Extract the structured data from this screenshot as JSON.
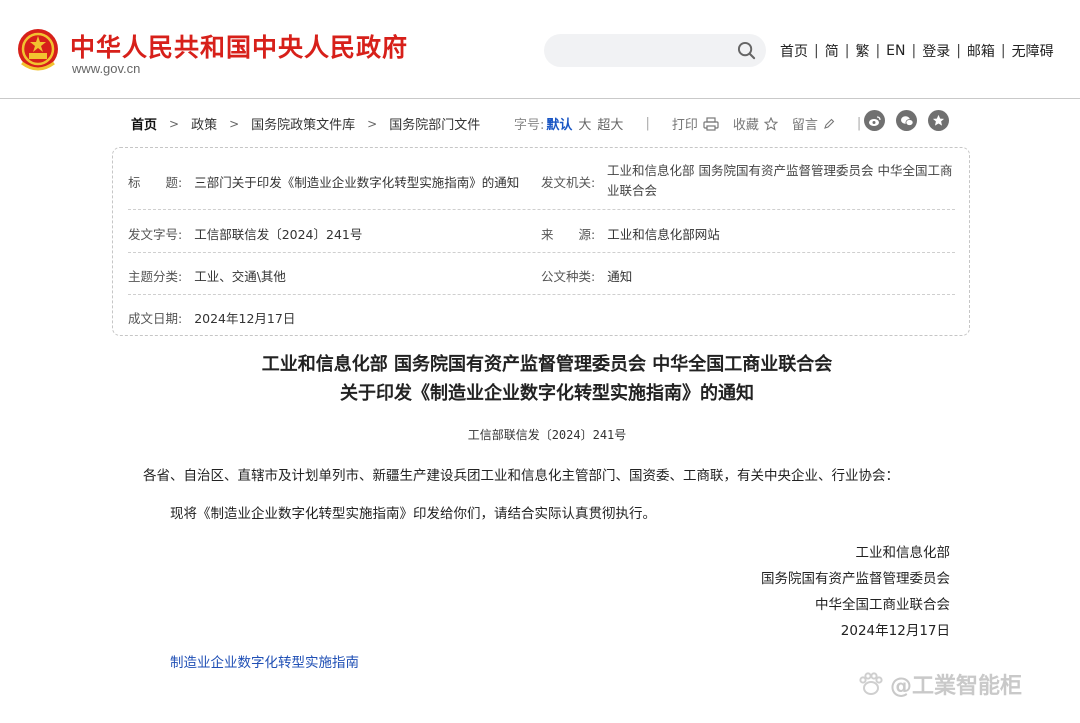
{
  "header": {
    "site_title": "中华人民共和国中央人民政府",
    "site_url": "www.gov.cn",
    "nav": [
      "首页",
      "简",
      "繁",
      "EN",
      "登录",
      "邮箱",
      "无障碍"
    ],
    "search_icon": "search-icon"
  },
  "breadcrumb": [
    "首页",
    "政策",
    "国务院政策文件库",
    "国务院部门文件"
  ],
  "toolbar": {
    "font_label": "字号:",
    "font_sizes": [
      "默认",
      "大",
      "超大"
    ],
    "print": "打印",
    "favorite": "收藏",
    "comment": "留言"
  },
  "info": {
    "title_key": "标　　题:",
    "title_val": "三部门关于印发《制造业企业数字化转型实施指南》的通知",
    "issuer_key": "发文机关:",
    "issuer_val_1": "工业和信息化部 国务院国有资产监督管理委员会 中华全国工商",
    "issuer_val_2": "业联合会",
    "docno_key": "发文字号:",
    "docno_val": "工信部联信发〔2024〕241号",
    "source_key": "来　　源:",
    "source_val": "工业和信息化部网站",
    "category_key": "主题分类:",
    "category_val": "工业、交通\\其他",
    "type_key": "公文种类:",
    "type_val": "通知",
    "date_key": "成文日期:",
    "date_val": "2024年12月17日"
  },
  "article": {
    "title_line1": "工业和信息化部 国务院国有资产监督管理委员会 中华全国工商业联合会",
    "title_line2": "关于印发《制造业企业数字化转型实施指南》的通知",
    "doc_no": "工信部联信发〔2024〕241号",
    "recipients": "各省、自治区、直辖市及计划单列市、新疆生产建设兵团工业和信息化主管部门、国资委、工商联，有关中央企业、行业协会：",
    "body": "现将《制造业企业数字化转型实施指南》印发给你们，请结合实际认真贯彻执行。",
    "signatures": [
      "工业和信息化部",
      "国务院国有资产监督管理委员会",
      "中华全国工商业联合会"
    ],
    "sign_date": "2024年12月17日",
    "attachment": "制造业企业数字化转型实施指南"
  },
  "watermark": "@工業智能柜",
  "colors": {
    "brand_red": "#d7201a",
    "link_blue": "#1f4fb5",
    "active_blue": "#1a56c4"
  }
}
